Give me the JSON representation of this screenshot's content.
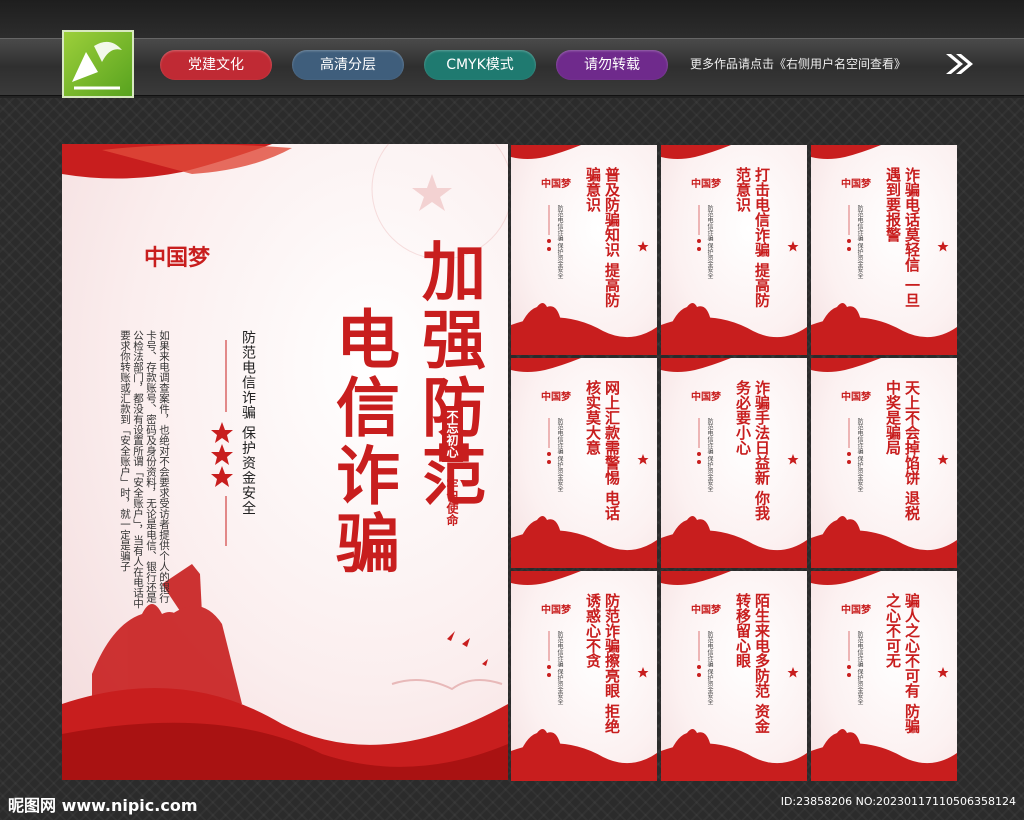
{
  "header": {
    "tags": [
      {
        "label": "党建文化",
        "color": "#c02a34"
      },
      {
        "label": "高清分层",
        "color": "#3f5e7c"
      },
      {
        "label": "CMYK模式",
        "color": "#1f7a70"
      },
      {
        "label": "请勿转载",
        "color": "#6f2a8c"
      }
    ],
    "more_text": "更多作品请点击《右侧用户名空间查看》"
  },
  "poster": {
    "logo_text": "中国梦",
    "title_line1": "加强防范",
    "title_line2": "电信诈骗",
    "subtitle": "防范电信诈骗 保护资金安全",
    "body": "如果来电调查案件，也绝对不会要求受访者提供个人的银行卡号、存款账号、密码及身份资料，无论是电信、银行还是公检法部门，都没有设置所谓「安全账户」，当有人在电话中要求你转账或汇款到「安全账户」时，就一定是骗子",
    "slogan1": "不忘初心",
    "slogan2": "牢记使命"
  },
  "cards": [
    {
      "title": "普及防骗知识 提高防骗意识"
    },
    {
      "title": "打击电信诈骗 提高防范意识"
    },
    {
      "title": "诈骗电话莫轻信 一旦遇到要报警"
    },
    {
      "title": "网上汇款需警惕 电话核实莫大意"
    },
    {
      "title": "诈骗手法日益新 你我务必要小心"
    },
    {
      "title": "天上不会掉馅饼 退税中奖是骗局"
    },
    {
      "title": "防范诈骗擦亮眼 拒绝诱惑心不贪"
    },
    {
      "title": "陌生来电多防范 资金转移留心眼"
    },
    {
      "title": "骗人之心不可有 防骗之心不可无"
    }
  ],
  "card_sub": "防范电信诈骗 保护资金安全",
  "card_logo": "中国梦",
  "footer": {
    "watermark": "昵图网 www.nipic.com",
    "id_text": "ID:23858206 NO:20230117110506358124"
  },
  "colors": {
    "red": "#c81e1e",
    "dark_red": "#a91212"
  }
}
